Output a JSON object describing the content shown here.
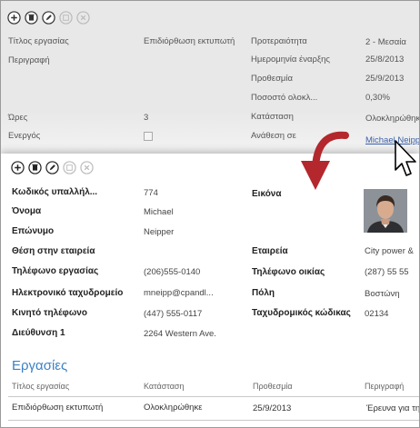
{
  "toolbar_icons": [
    "add-icon",
    "delete-icon",
    "edit-icon",
    "save-icon",
    "cancel-icon"
  ],
  "task_form": {
    "title_label": "Τίτλος εργασίας",
    "title_value": "Επιδιόρθωση εκτυπωτή",
    "description_label": "Περιγραφή",
    "priority_label": "Προτεραιότητα",
    "priority_value": "2 - Μεσαία",
    "start_date_label": "Ημερομηνία έναρξης",
    "start_date_value": "25/8/2013",
    "due_date_label": "Προθεσμία",
    "due_date_value": "25/9/2013",
    "percent_label": "Ποσοστό ολοκλ...",
    "percent_value": "0,30%",
    "hours_label": "Ώρες",
    "hours_value": "3",
    "status_label": "Κατάσταση",
    "status_value": "Ολοκληρώθηκε",
    "active_label": "Ενεργός",
    "assigned_label": "Ανάθεση σε",
    "assigned_value": "Michael Neipper"
  },
  "employee_form": {
    "id_label": "Κωδικός υπαλλήλ...",
    "id_value": "774",
    "picture_label": "Εικόνα",
    "first_name_label": "Όνομα",
    "first_name_value": "Michael",
    "last_name_label": "Επώνυμο",
    "last_name_value": "Neipper",
    "position_label": "Θέση στην εταιρεία",
    "company_label": "Εταιρεία",
    "company_value": "City power &",
    "work_phone_label": "Τηλέφωνο εργασίας",
    "work_phone_value": "(206)555-0140",
    "home_phone_label": "Τηλέφωνο οικίας",
    "home_phone_value": "(287) 55 55",
    "email_label": "Ηλεκτρονικό ταχυδρομείο",
    "email_value": "mneipp@cpandl...",
    "city_label": "Πόλη",
    "city_value": "Βοστώνη",
    "mobile_label": "Κινητό τηλέφωνο",
    "mobile_value": "(447) 555-0117",
    "zip_label": "Ταχυδρομικός κώδικας",
    "zip_value": "02134",
    "address_label": "Διεύθυνση 1",
    "address_value": "2264 Western Ave."
  },
  "tasks_section": {
    "heading": "Εργασίες",
    "columns": [
      "Τίτλος εργασίας",
      "Κατάσταση",
      "Προθεσμία",
      "Περιγραφή"
    ],
    "rows": [
      [
        "Επιδιόρθωση εκτυπωτή",
        "Ολοκληρώθηκε",
        "25/9/2013",
        "Έρευνα για τη"
      ]
    ]
  },
  "colors": {
    "accent": "#3b82c4",
    "arrow": "#b3272d",
    "background_form": "#e8e8e8",
    "link": "#3b5fa8"
  }
}
